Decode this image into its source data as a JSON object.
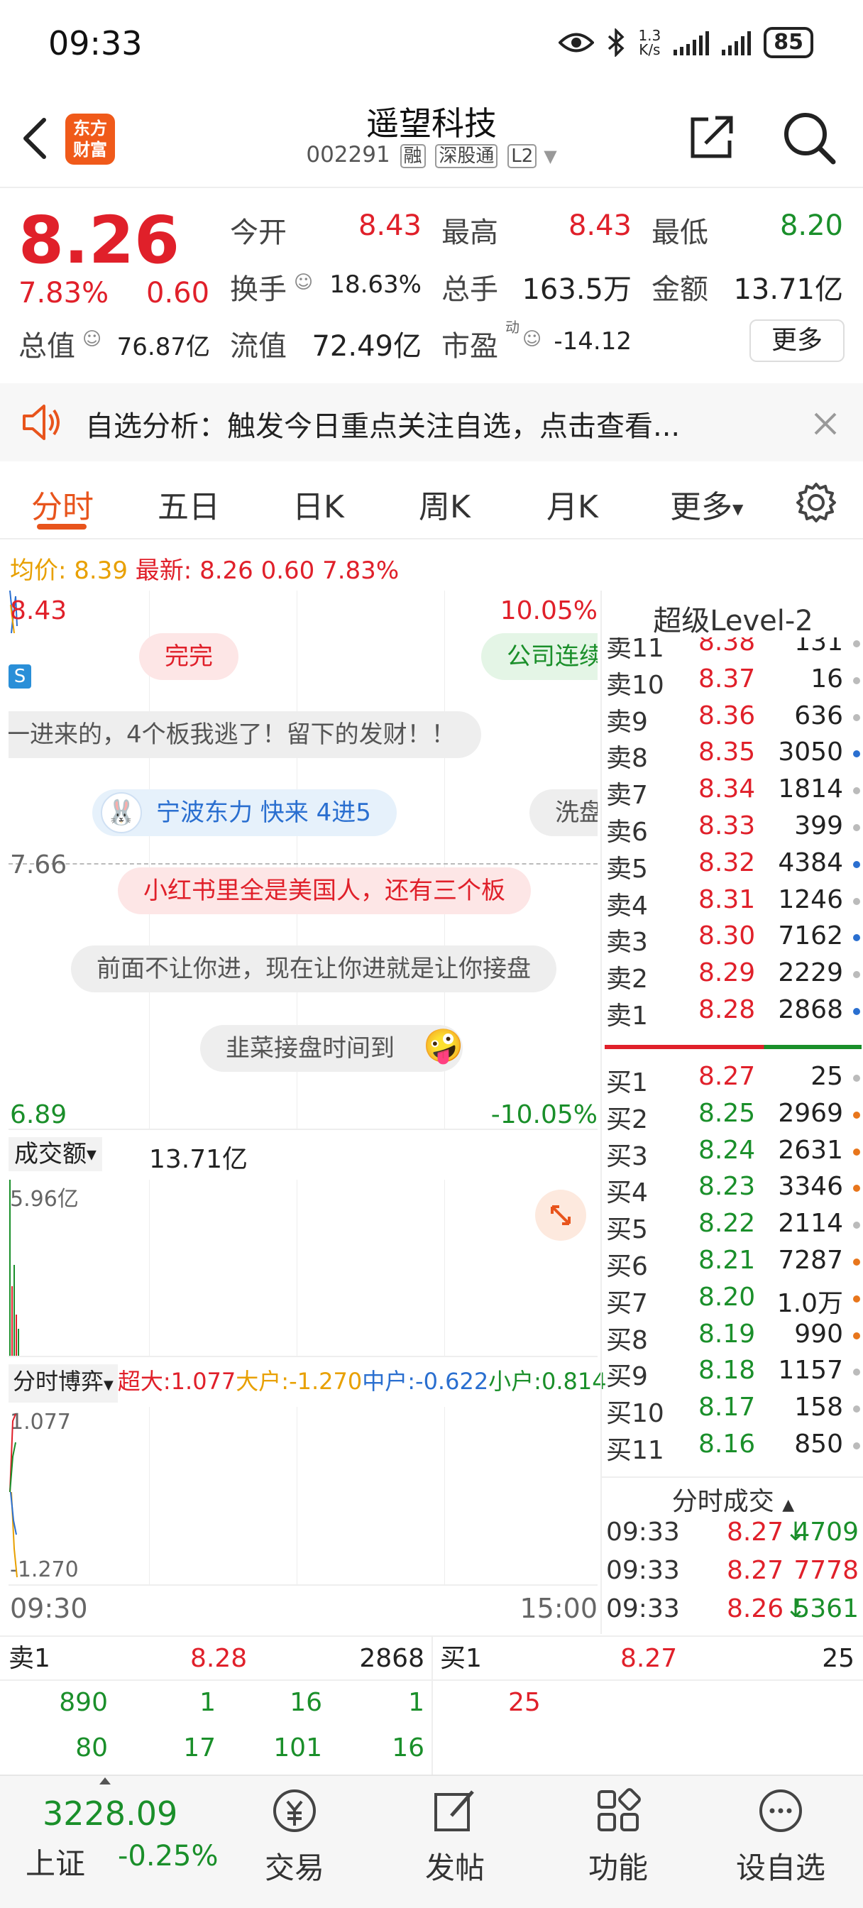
{
  "status_bar": {
    "time": "09:33",
    "net_speed_value": "1.3",
    "net_speed_unit": "K/s",
    "battery": "85",
    "icons": [
      "eye-icon",
      "bluetooth-icon",
      "signal-icon",
      "signal-icon"
    ]
  },
  "header": {
    "title": "遥望科技",
    "code": "002291",
    "tags": [
      "融",
      "深股通",
      "L2"
    ],
    "logo_line1": "东方",
    "logo_line2": "财富",
    "icons": [
      "back-icon",
      "share-icon",
      "search-icon"
    ]
  },
  "quote": {
    "price": "8.26",
    "pct": "7.83%",
    "chg": "0.60",
    "open_label": "今开",
    "open": "8.43",
    "high_label": "最高",
    "high": "8.43",
    "low_label": "最低",
    "low": "8.20",
    "turnover_label": "换手",
    "turnover": "18.63%",
    "volume_label": "总手",
    "volume": "163.5万",
    "amount_label": "金额",
    "amount": "13.71亿",
    "mktcap_label": "总值",
    "mktcap": "76.87亿",
    "float_label": "流值",
    "float": "72.49亿",
    "pe_label": "市盈",
    "pe_super": "动",
    "pe": "-14.12",
    "more_label": "更多"
  },
  "banner": {
    "text": "自选分析：触发今日重点关注自选，点击查看...",
    "icons": [
      "speaker-icon",
      "close-icon"
    ]
  },
  "tabs": {
    "items": [
      "分时",
      "五日",
      "日K",
      "周K",
      "月K",
      "更多"
    ],
    "active": "分时",
    "more_icon": "caret-down-icon",
    "settings_icon": "gear-icon"
  },
  "avg_line": {
    "avg_label": "均价:",
    "avg": "8.39",
    "latest_label": "最新:",
    "latest": "8.26",
    "chg": "0.60",
    "pct": "7.83%"
  },
  "intraday": {
    "top_price": "8.43",
    "top_pct": "10.05%",
    "mid_price": "7.66",
    "bottom_price": "6.89",
    "bottom_pct": "-10.05%",
    "marker": "S",
    "bullets": [
      "完完",
      "公司连续",
      "一进来的，4个板我逃了！留下的发财！！",
      "宁波东力 快来 4进5",
      "洗盘",
      "小红书里全是美国人，还有三个板",
      "前面不让你进，现在让你进就是让你接盘",
      "韭菜接盘时间到"
    ],
    "volume_select": "成交额",
    "volume_value": "13.71亿",
    "volume_max": "5.96亿",
    "flow_select": "分时博弈",
    "flow": [
      {
        "label": "超大:",
        "value": "1.077",
        "color": "#e0202a"
      },
      {
        "label": "大户:",
        "value": "-1.270",
        "color": "#e8a000"
      },
      {
        "label": "中户:",
        "value": "-0.622",
        "color": "#2a6fd0"
      },
      {
        "label": "小户:",
        "value": "0.814",
        "color": "#1a8f2a"
      }
    ],
    "flow_max": "1.077",
    "flow_min": "-1.270",
    "time_start": "09:30",
    "time_end": "15:00",
    "icons": [
      "expand-icon",
      "caret-down-icon"
    ]
  },
  "order_book": {
    "title": "超级Level-2",
    "asks": [
      {
        "label": "卖11",
        "price": "8.38",
        "vol": "131",
        "dot": "#bbbbbb"
      },
      {
        "label": "卖10",
        "price": "8.37",
        "vol": "16",
        "dot": "#bbbbbb"
      },
      {
        "label": "卖9",
        "price": "8.36",
        "vol": "636",
        "dot": "#bbbbbb"
      },
      {
        "label": "卖8",
        "price": "8.35",
        "vol": "3050",
        "dot": "#2a6fd0"
      },
      {
        "label": "卖7",
        "price": "8.34",
        "vol": "1814",
        "dot": "#bbbbbb"
      },
      {
        "label": "卖6",
        "price": "8.33",
        "vol": "399",
        "dot": "#bbbbbb"
      },
      {
        "label": "卖5",
        "price": "8.32",
        "vol": "4384",
        "dot": "#2a6fd0"
      },
      {
        "label": "卖4",
        "price": "8.31",
        "vol": "1246",
        "dot": "#bbbbbb"
      },
      {
        "label": "卖3",
        "price": "8.30",
        "vol": "7162",
        "dot": "#2a6fd0"
      },
      {
        "label": "卖2",
        "price": "8.29",
        "vol": "2229",
        "dot": "#bbbbbb"
      },
      {
        "label": "卖1",
        "price": "8.28",
        "vol": "2868",
        "dot": "#2a6fd0"
      }
    ],
    "bids": [
      {
        "label": "买1",
        "price": "8.27",
        "vol": "25",
        "dot": "#bbbbbb"
      },
      {
        "label": "买2",
        "price": "8.25",
        "vol": "2969",
        "dot": "#e8761c"
      },
      {
        "label": "买3",
        "price": "8.24",
        "vol": "2631",
        "dot": "#e8761c"
      },
      {
        "label": "买4",
        "price": "8.23",
        "vol": "3346",
        "dot": "#e8761c"
      },
      {
        "label": "买5",
        "price": "8.22",
        "vol": "2114",
        "dot": "#bbbbbb"
      },
      {
        "label": "买6",
        "price": "8.21",
        "vol": "7287",
        "dot": "#e8761c"
      },
      {
        "label": "买7",
        "price": "8.20",
        "vol": "1.0万",
        "dot": "#e8761c"
      },
      {
        "label": "买8",
        "price": "8.19",
        "vol": "990",
        "dot": "#e8761c"
      },
      {
        "label": "买9",
        "price": "8.18",
        "vol": "1157",
        "dot": "#bbbbbb"
      },
      {
        "label": "买10",
        "price": "8.17",
        "vol": "158",
        "dot": "#bbbbbb"
      },
      {
        "label": "买11",
        "price": "8.16",
        "vol": "850",
        "dot": "#bbbbbb"
      }
    ],
    "ticks_title": "分时成交",
    "ticks": [
      {
        "time": "09:33",
        "price": "8.27",
        "arrow": "↓",
        "vol": "4709"
      },
      {
        "time": "09:33",
        "price": "8.27",
        "arrow": "",
        "vol": "7778"
      },
      {
        "time": "09:33",
        "price": "8.26",
        "arrow": "↓",
        "vol": "5361"
      }
    ]
  },
  "bottom_quote": {
    "ask_label": "卖1",
    "ask_price": "8.28",
    "ask_vol": "2868",
    "bid_label": "买1",
    "bid_price": "8.27",
    "bid_vol": "25",
    "ask_queue": [
      "890",
      "1",
      "16",
      "1",
      "80",
      "17",
      "101",
      "16"
    ],
    "bid_queue": [
      "25"
    ]
  },
  "navbar": {
    "index_value": "3228.09",
    "index_name": "上证",
    "index_pct": "-0.25%",
    "items": [
      {
        "label": "交易",
        "icon": "yuan-icon"
      },
      {
        "label": "发帖",
        "icon": "edit-icon"
      },
      {
        "label": "功能",
        "icon": "grid-icon"
      },
      {
        "label": "设自选",
        "icon": "more-icon"
      }
    ]
  }
}
